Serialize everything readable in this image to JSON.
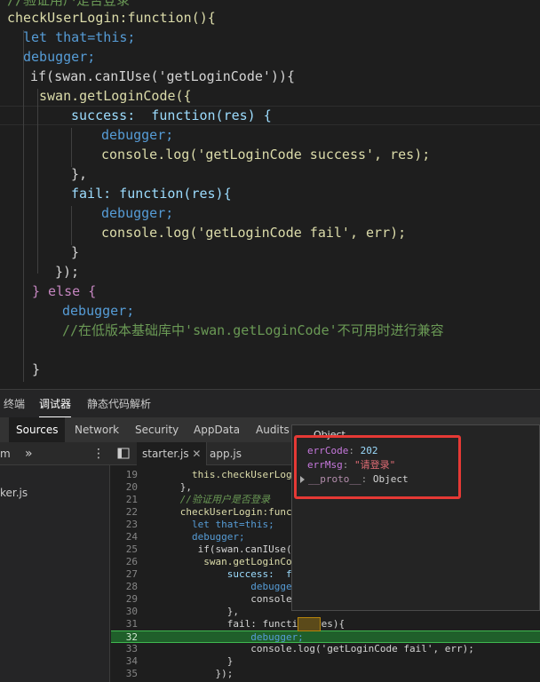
{
  "editor": {
    "lines": [
      "//验证用户是否登录",
      "checkUserLogin:function(){",
      "let that=this;",
      "debugger;",
      "if(swan.canIUse('getLoginCode')){",
      "swan.getLoginCode({",
      "success:  function(res) {",
      "debugger;",
      "console.log('getLoginCode success', res);",
      "},",
      "fail: function(res){",
      "debugger;",
      "console.log('getLoginCode fail', err);",
      "}",
      "});",
      "} else {",
      "debugger;",
      "//在低版本基础库中'swan.getLoginCode'不可用时进行兼容",
      "}"
    ]
  },
  "devtools": {
    "top_tabs": [
      "终端",
      "调试器",
      "静态代码解析"
    ],
    "panel_tabs": [
      "Sources",
      "Network",
      "Security",
      "AppData",
      "Audits"
    ],
    "navigator_prefix": "m",
    "more_label": "»",
    "menu_label": "⋮",
    "file_tabs": [
      "starter.js",
      "app.js"
    ],
    "navigator_file": "ker.js"
  },
  "source": {
    "rows": [
      {
        "n": "19",
        "code": "        this.checkUserLogi"
      },
      {
        "n": "20",
        "code": "      },"
      },
      {
        "n": "21",
        "code": "      //验证用户是否登录"
      },
      {
        "n": "22",
        "code": "      checkUserLogin:functio"
      },
      {
        "n": "23",
        "code": "        let that=this;"
      },
      {
        "n": "24",
        "code": "        debugger;"
      },
      {
        "n": "25",
        "code": "         if(swan.canIUse('ge"
      },
      {
        "n": "26",
        "code": "          swan.getLoginCode("
      },
      {
        "n": "27",
        "code": "              success:  func"
      },
      {
        "n": "28",
        "code": "                  debugger;"
      },
      {
        "n": "29",
        "code": "                  console.lo"
      },
      {
        "n": "30",
        "code": "              },"
      },
      {
        "n": "31",
        "code": "              fail: function(res){"
      },
      {
        "n": "32",
        "code": "                  debugger;"
      },
      {
        "n": "33",
        "code": "                  console.log('getLoginCode fail', err);"
      },
      {
        "n": "34",
        "code": "              }"
      },
      {
        "n": "35",
        "code": "            });"
      }
    ]
  },
  "popover": {
    "title": "Object",
    "err_code_key": "errCode",
    "err_code_value": "202",
    "err_msg_key": "errMsg",
    "err_msg_value": "\"请登录\"",
    "proto_key": "__proto__",
    "proto_value": "Object"
  }
}
